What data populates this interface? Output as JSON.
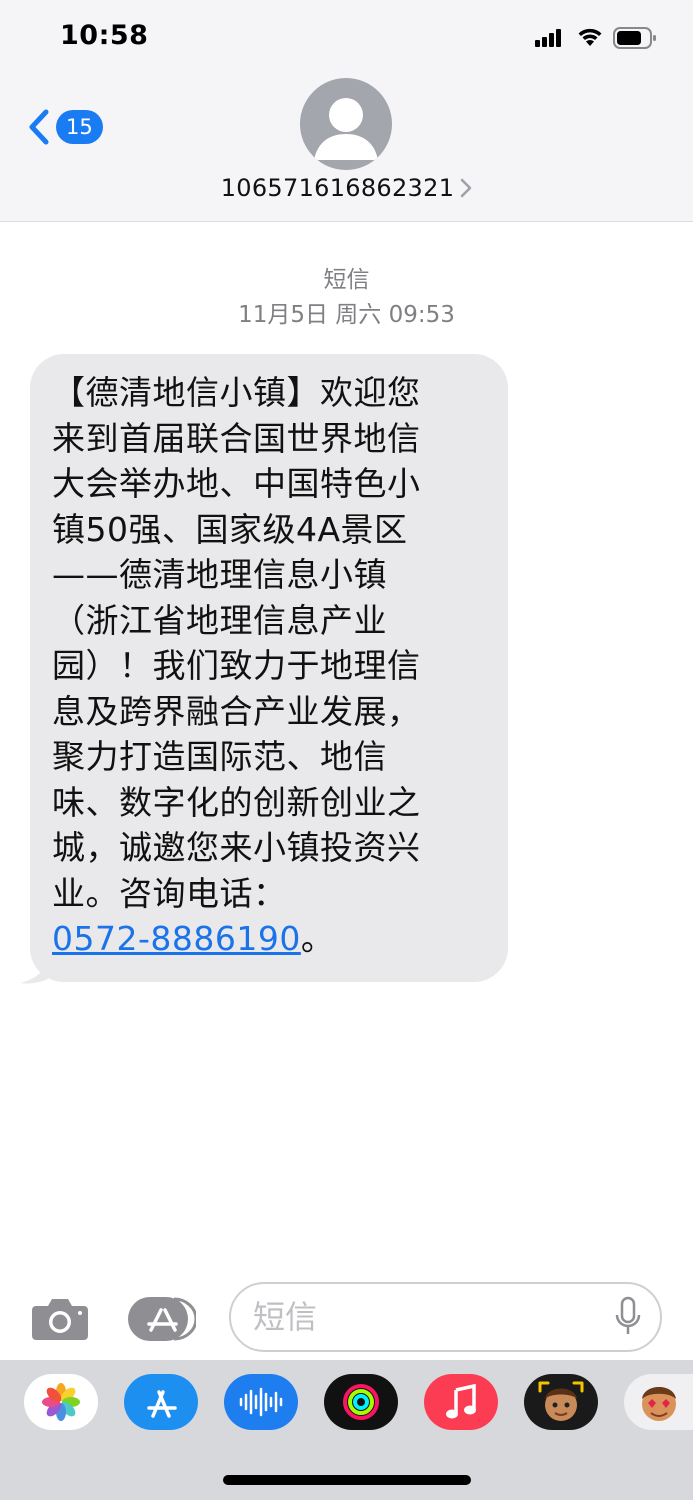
{
  "status_bar": {
    "time": "10:58"
  },
  "header": {
    "back_badge_count": "15",
    "contact_number": "106571616862321"
  },
  "conversation": {
    "service_label": "短信",
    "timestamp": "11月5日 周六 09:53",
    "message": {
      "text_lines": [
        "【德清地信小镇】欢迎您",
        "来到首届联合国世界地信",
        "大会举办地、中国特色小",
        "镇50强、国家级4A景区",
        "——德清地理信息小镇",
        "（浙江省地理信息产业",
        "园）！我们致力于地理信",
        "息及跨界融合产业发展，",
        "聚力打造国际范、地信",
        "味、数字化的创新创业之",
        "城，诚邀您来小镇投资兴",
        "业。咨询电话："
      ],
      "phone_link": "0572-8886190",
      "trailing_punct": "。"
    }
  },
  "input_bar": {
    "placeholder": "短信"
  },
  "app_drawer": {
    "apps": [
      {
        "name": "photos-app-icon"
      },
      {
        "name": "app-store-icon"
      },
      {
        "name": "audio-message-icon"
      },
      {
        "name": "fitness-activity-icon"
      },
      {
        "name": "music-app-icon"
      },
      {
        "name": "memoji-icon"
      },
      {
        "name": "memoji-stickers-icon"
      }
    ]
  },
  "colors": {
    "header_bg": "#f5f5f7",
    "bubble_bg": "#e9e9eb",
    "link": "#1a73e8",
    "badge": "#1a7cf2",
    "drawer_bg": "#d7d8dc"
  }
}
